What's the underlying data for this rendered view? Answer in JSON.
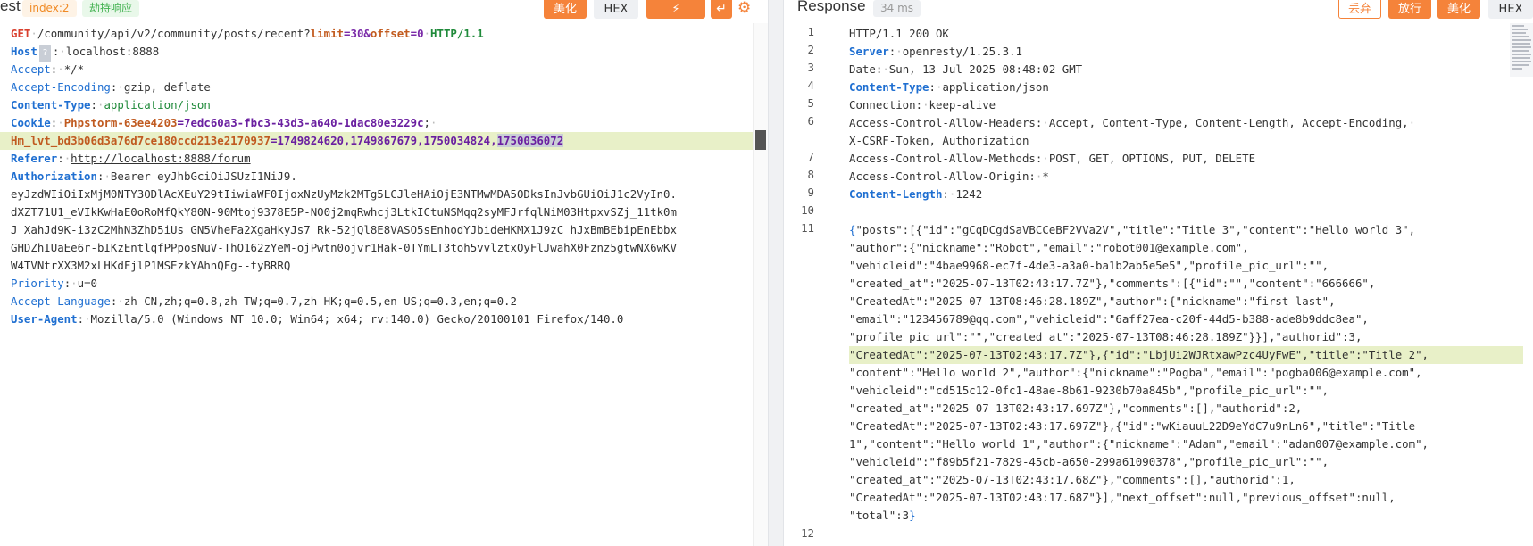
{
  "request": {
    "title": "est",
    "index_tag": "index:2",
    "intercept_tag": "劫持响应",
    "beautify_label": "美化",
    "hex_label": "HEX",
    "fuzz_label": "⚡ FUZZ",
    "wrap_icon": "wrap-icon",
    "settings_icon": "gear-icon",
    "lines": {
      "l1": {
        "method": "GET",
        "path": "/community/api/v2/community/posts/recent?",
        "p1k": "limit",
        "p1v": "=30&",
        "p2k": "offset",
        "p2v": "=0",
        "proto": "HTTP/1.1"
      },
      "l2": {
        "k": "Host",
        "tag": "?",
        "v": "localhost:8888"
      },
      "l3": {
        "k": "Accept",
        "v": "*/*"
      },
      "l4": {
        "k": "Accept-Encoding",
        "v": "gzip, deflate"
      },
      "l5": {
        "k": "Content-Type",
        "v": "application/json"
      },
      "l6": {
        "k": "Cookie",
        "ck": "Phpstorm-63ee4203",
        "cv": "=7edc60a3-fbc3-43d3-a640-1dac80e3229c",
        "tail": ";"
      },
      "l7": {
        "ck": "Hm_lvt_bd3b06d3a76d7ce180ccd213e2170937",
        "cv": "=1749824620,1749867679,1750034824,",
        "sel": "1750036072"
      },
      "l8": {
        "k": "Referer",
        "v": "http://localhost:8888/forum"
      },
      "l9": {
        "k": "Authorization",
        "v": "Bearer eyJhbGciOiJSUzI1NiJ9."
      },
      "l10": "eyJzdWIiOiIxMjM0NTY3ODlAcXEuY29tIiwiaWF0IjoxNzUyMzk2MTg5LCJleHAiOjE3NTMwMDA5ODksInJvbGUiOiJ1c2VyIn0.",
      "l11": "dXZT71U1_eVIkKwHaE0oRoMfQkY80N-90Mtoj9378E5P-NO0j2mqRwhcj3LtkICtuNSMqq2syMFJrfqlNiM03HtpxvSZj_11tk0m",
      "l12": "J_XahJd9K-i3zC2MhN3ZhD5iUs_GN5VheFa2XgaHkyJs7_Rk-52jQl8E8VASO5sEnhodYJbideHKMX1J9zC_hJxBmBEbipEnEbbx",
      "l13": "GHDZhIUaEe6r-bIKzEntlqfPPposNuV-ThO162zYeM-ojPwtn0ojvr1Hak-0TYmLT3toh5vvlztxOyFlJwahX0Fznz5gtwNX6wKV",
      "l14": "W4TVNtrXX3M2xLHKdFjlP1MSEzkYAhnQFg--tyBRRQ",
      "l15": {
        "k": "Priority",
        "v": "u=0"
      },
      "l16": {
        "k": "Accept-Language",
        "v": "zh-CN,zh;q=0.8,zh-TW;q=0.7,zh-HK;q=0.5,en-US;q=0.3,en;q=0.2"
      },
      "l17": {
        "k": "User-Agent",
        "v": "Mozilla/5.0 (Windows NT 10.0; Win64; x64; rv:140.0) Gecko/20100101 Firefox/140.0"
      }
    }
  },
  "response": {
    "title": "Response",
    "time_tag": "34 ms",
    "discard_label": "丢弃",
    "release_label": "放行",
    "beautify_label": "美化",
    "hex_label": "HEX",
    "line_numbers": [
      "1",
      "2",
      "3",
      "4",
      "5",
      "6",
      "7",
      "8",
      "9",
      "10",
      "11",
      "12"
    ],
    "lines": {
      "r1": "HTTP/1.1 200 OK",
      "r2": {
        "k": "Server",
        "v": "openresty/1.25.3.1"
      },
      "r3": {
        "k": "Date",
        "v": "Sun, 13 Jul 2025 08:48:02 GMT"
      },
      "r4": {
        "k": "Content-Type",
        "v": "application/json"
      },
      "r5": {
        "k": "Connection",
        "v": "keep-alive"
      },
      "r6": {
        "k": "Access-Control-Allow-Headers",
        "v": "Accept, Content-Type, Content-Length, Accept-Encoding,"
      },
      "r6b": "X-CSRF-Token, Authorization",
      "r7": {
        "k": "Access-Control-Allow-Methods",
        "v": "POST, GET, OPTIONS, PUT, DELETE"
      },
      "r8": {
        "k": "Access-Control-Allow-Origin",
        "v": "*"
      },
      "r9": {
        "k": "Content-Length",
        "v": "1242"
      },
      "b1a": "{",
      "b1b": "\"posts\":[{\"id\":\"gCqDCgdSaVBCCeBF2VVa2V\",\"title\":\"Title 3\",\"content\":\"Hello world 3\",",
      "b2": "\"author\":{\"nickname\":\"Robot\",\"email\":\"robot001@example.com\",",
      "b3": "\"vehicleid\":\"4bae9968-ec7f-4de3-a3a0-ba1b2ab5e5e5\",\"profile_pic_url\":\"\",",
      "b4": "\"created_at\":\"2025-07-13T02:43:17.7Z\"},\"comments\":[{\"id\":\"\",\"content\":\"666666\",",
      "b5": "\"CreatedAt\":\"2025-07-13T08:46:28.189Z\",\"author\":{\"nickname\":\"first last\",",
      "b6": "\"email\":\"123456789@qq.com\",\"vehicleid\":\"6aff27ea-c20f-44d5-b388-ade8b9ddc8ea\",",
      "b7": "\"profile_pic_url\":\"\",\"created_at\":\"2025-07-13T08:46:28.189Z\"}}],\"authorid\":3,",
      "b8": "\"CreatedAt\":\"2025-07-13T02:43:17.7Z\"},{\"id\":\"LbjUi2WJRtxawPzc4UyFwE\",\"title\":\"Title 2\",",
      "b9": "\"content\":\"Hello world 2\",\"author\":{\"nickname\":\"Pogba\",\"email\":\"pogba006@example.com\",",
      "b10": "\"vehicleid\":\"cd515c12-0fc1-48ae-8b61-9230b70a845b\",\"profile_pic_url\":\"\",",
      "b11": "\"created_at\":\"2025-07-13T02:43:17.697Z\"},\"comments\":[],\"authorid\":2,",
      "b12": "\"CreatedAt\":\"2025-07-13T02:43:17.697Z\"},{\"id\":\"wKiauuL22D9eYdC7u9nLn6\",\"title\":\"Title",
      "b13": "1\",\"content\":\"Hello world 1\",\"author\":{\"nickname\":\"Adam\",\"email\":\"adam007@example.com\",",
      "b14": "\"vehicleid\":\"f89b5f21-7829-45cb-a650-299a61090378\",\"profile_pic_url\":\"\",",
      "b15": "\"created_at\":\"2025-07-13T02:43:17.68Z\"},\"comments\":[],\"authorid\":1,",
      "b16": "\"CreatedAt\":\"2025-07-13T02:43:17.68Z\"}],\"next_offset\":null,\"previous_offset\":null,",
      "b17a": "\"total\":3",
      "b17b": "}"
    }
  },
  "colors": {
    "accent": "#f5833a",
    "key": "#1f6fd1",
    "highlight": "#e8f0c8"
  }
}
